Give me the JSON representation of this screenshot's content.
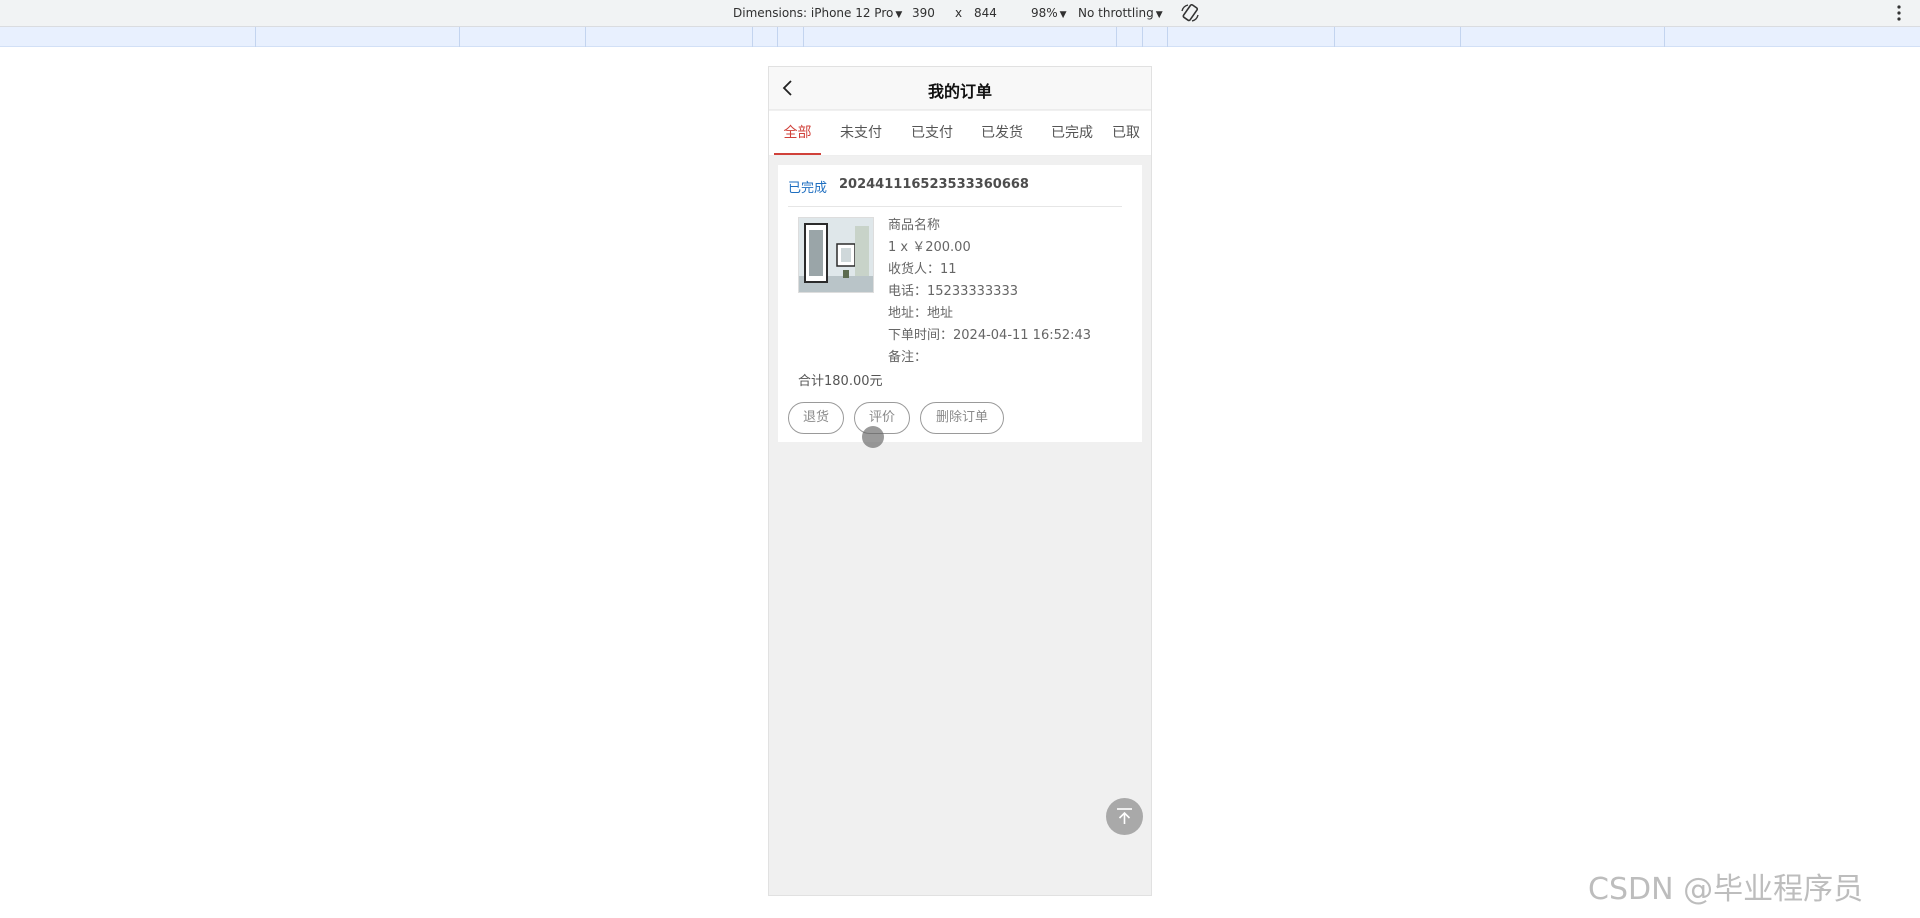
{
  "devtools": {
    "dimensions_label": "Dimensions: iPhone 12 Pro",
    "width_value": "390",
    "times": "x",
    "height_value": "844",
    "zoom": "98%",
    "throttling": "No throttling",
    "rotate_icon": "rotate-icon",
    "menu_icon": "kebab-menu-icon"
  },
  "nav": {
    "back_icon": "chevron-left-icon",
    "title": "我的订单"
  },
  "tabs": [
    {
      "label": "全部",
      "active": true
    },
    {
      "label": "未支付",
      "active": false
    },
    {
      "label": "已支付",
      "active": false
    },
    {
      "label": "已发货",
      "active": false
    },
    {
      "label": "已完成",
      "active": false
    },
    {
      "label": "已取",
      "active": false
    }
  ],
  "order": {
    "status": "已完成",
    "order_no": "202441116523533360668",
    "product_name": "商品名称",
    "qty_price": "1 x ￥200.00",
    "receiver": "收货人：11",
    "phone": "电话：15233333333",
    "address": "地址：地址",
    "order_time": "下单时间：2024-04-11 16:52:43",
    "remark": "备注：",
    "total": "合计180.00元",
    "actions": {
      "return": "退货",
      "review": "评价",
      "delete": "删除订单"
    }
  },
  "back_to_top_icon": "arrow-up-to-top-icon",
  "watermark": "CSDN @毕业程序员",
  "colors": {
    "active_tab": "#d0413a",
    "status": "#1f6fc0",
    "page_bg": "#f0f0f0"
  }
}
